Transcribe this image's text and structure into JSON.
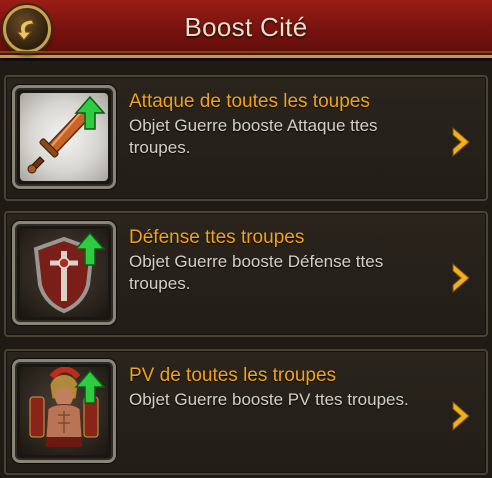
{
  "header": {
    "title": "Boost Cité",
    "back_icon": "back-arrow-icon"
  },
  "colors": {
    "header_red": "#7d1410",
    "gold_border": "#c39a4c",
    "title_orange": "#f2a31b",
    "desc_text": "#d6d1c8",
    "boost_green": "#2ecc40"
  },
  "boosts": [
    {
      "title": "Attaque de toutes les toupes",
      "description": "Objet Guerre booste Attaque ttes troupes.",
      "icon": "sword-icon"
    },
    {
      "title": "Défense ttes troupes",
      "description": "Objet Guerre booste Défense ttes troupes.",
      "icon": "shield-icon"
    },
    {
      "title": "PV de toutes les troupes",
      "description": "Objet Guerre booste PV ttes troupes.",
      "icon": "spartan-warrior-icon"
    }
  ]
}
